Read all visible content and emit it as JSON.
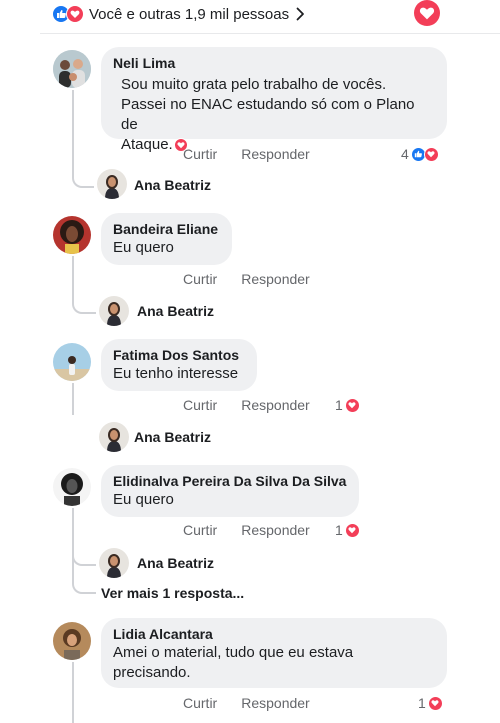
{
  "reactions_bar": {
    "summary": "Você e outras 1,9 mil pessoas",
    "chevron": "chevron-right-icon"
  },
  "colors": {
    "like": "#1877f2",
    "love": "#f33e58",
    "bubble": "#eff0f2",
    "muted": "#65676b"
  },
  "actions": {
    "like": "Curtir",
    "reply": "Responder"
  },
  "comments": [
    {
      "name": "Neli Lima",
      "lines": [
        "Sou muito grata pelo trabalho de vocês.",
        "Passei no ENAC estudando só com o Plano de",
        "Ataque."
      ],
      "count": "4",
      "reply_author": "Ana Beatriz"
    },
    {
      "name": "Bandeira Eliane",
      "lines": [
        "Eu quero"
      ],
      "count": "",
      "reply_author": "Ana Beatriz"
    },
    {
      "name": "Fatima Dos Santos",
      "lines": [
        "Eu tenho interesse"
      ],
      "count": "1",
      "reply_author": "Ana Beatriz"
    },
    {
      "name": "Elidinalva Pereira Da Silva Da Silva",
      "lines": [
        "Eu quero"
      ],
      "count": "1",
      "reply_author": "Ana Beatriz",
      "more_replies": "Ver mais 1 resposta..."
    },
    {
      "name": "Lidia Alcantara",
      "lines": [
        "Amei o material, tudo que eu estava",
        "precisando."
      ],
      "count": "1"
    }
  ]
}
